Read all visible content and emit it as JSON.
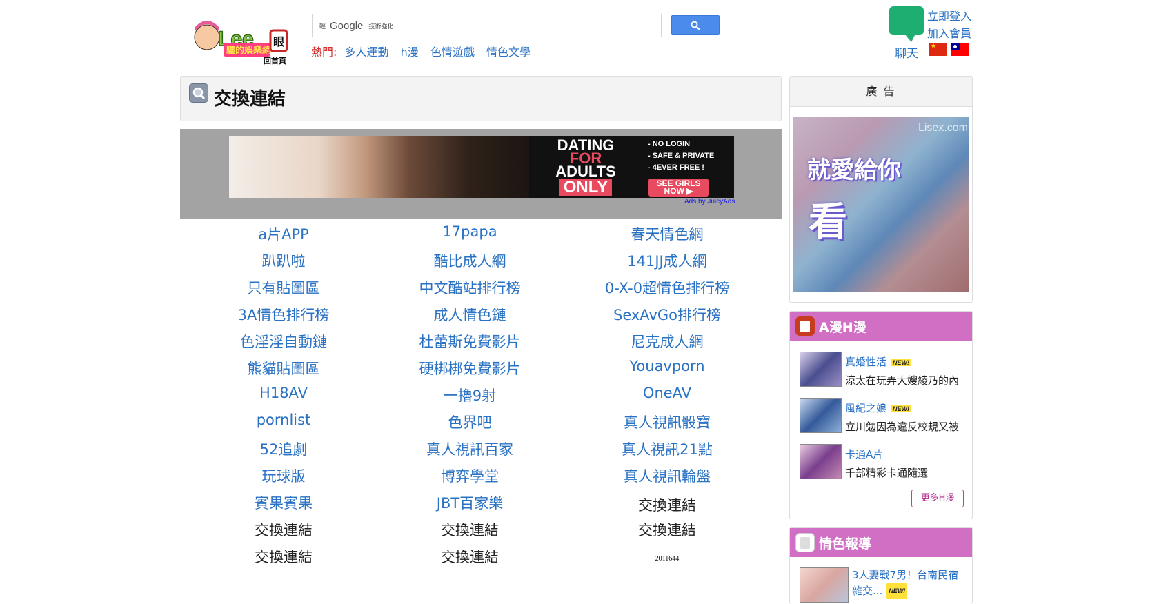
{
  "header": {
    "logo_home_label": "回首頁",
    "search": {
      "small_label": "輕",
      "brand": "Google",
      "enhanced_label": "技術強化"
    },
    "hot": {
      "label": "熱門:",
      "links": [
        "多人運動",
        "h漫",
        "色情遊戲",
        "情色文學"
      ]
    },
    "user": {
      "login": "立即登入",
      "join": "加入會員",
      "chat": "聊天"
    }
  },
  "title_panel": {
    "title": "交換連結"
  },
  "ad_banner": {
    "headline_1": "DATING",
    "headline_2": "FOR",
    "headline_3": "ADULTS",
    "headline_4": "ONLY",
    "bullets": [
      "- NO LOGIN",
      "- SAFE & PRIVATE",
      "- 4EVER FREE !"
    ],
    "cta": "SEE GIRLS NOW ▶",
    "credit": "Ads by JuicyAds"
  },
  "links": [
    [
      "a片APP",
      "17papa",
      "春天情色網"
    ],
    [
      "趴趴啦",
      "酷比成人網",
      "141JJ成人網"
    ],
    [
      "只有貼圖區",
      "中文酷站排行榜",
      "0-X-0超情色排行榜"
    ],
    [
      "3A情色排行榜",
      "成人情色鏈",
      "SexAvGo排行榜"
    ],
    [
      "色淫淫自動鏈",
      "杜蕾斯免費影片",
      "尼克成人網"
    ],
    [
      "熊貓貼圖區",
      "硬梆梆免費影片",
      "Youavporn"
    ],
    [
      "H18AV",
      "一擼9射",
      "OneAV"
    ],
    [
      "pornlist",
      "色界吧",
      "真人視訊骰寶"
    ],
    [
      "52追劇",
      "真人視訊百家",
      "真人視訊21點"
    ],
    [
      "玩球版",
      "博弈學堂",
      "真人視訊輪盤"
    ],
    [
      "賓果賓果",
      "JBT百家樂",
      "交換連結"
    ],
    [
      "交換連結",
      "交換連結",
      "交換連結"
    ],
    [
      "交換連結",
      "交換連結",
      "2011644"
    ]
  ],
  "sidebar": {
    "ad": {
      "header": "廣 告",
      "watermark": "Lisex.com",
      "text_1": "就愛給你",
      "text_2": "看"
    },
    "manga_box": {
      "title": "A漫H漫",
      "items": [
        {
          "title": "真婚性活",
          "badge": "NEW!",
          "desc": "涼太在玩弄大嫂綾乃的內"
        },
        {
          "title": "風紀之娘",
          "badge": "NEW!",
          "desc": "立川勉因為違反校規又被"
        },
        {
          "title": "卡通A片",
          "badge": "",
          "desc": "千部精彩卡通隨選"
        }
      ],
      "more": "更多H漫"
    },
    "news_box": {
      "title": "情色報導",
      "item_title": "3人妻戰7男！台南民宿雜交...",
      "badge": "NEW!"
    }
  }
}
